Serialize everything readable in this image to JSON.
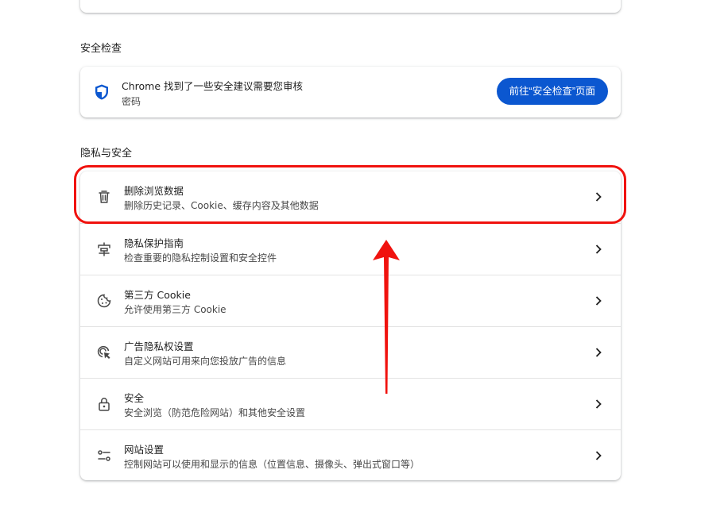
{
  "safety_check": {
    "section_title": "安全检查",
    "title": "Chrome 找到了一些安全建议需要您审核",
    "subtitle": "密码",
    "button_label": "前往“安全检查”页面"
  },
  "privacy": {
    "section_title": "隐私与安全",
    "items": [
      {
        "title": "删除浏览数据",
        "subtitle": "删除历史记录、Cookie、缓存内容及其他数据",
        "icon": "trash-icon"
      },
      {
        "title": "隐私保护指南",
        "subtitle": "检查重要的隐私控制设置和安全控件",
        "icon": "privacy-guide-icon"
      },
      {
        "title": "第三方 Cookie",
        "subtitle": "允许使用第三方 Cookie",
        "icon": "cookie-icon"
      },
      {
        "title": "广告隐私权设置",
        "subtitle": "自定义网站可用来向您投放广告的信息",
        "icon": "ad-privacy-icon"
      },
      {
        "title": "安全",
        "subtitle": "安全浏览（防范危险网站）和其他安全设置",
        "icon": "lock-icon"
      },
      {
        "title": "网站设置",
        "subtitle": "控制网站可以使用和显示的信息（位置信息、摄像头、弹出式窗口等）",
        "icon": "sliders-icon"
      }
    ]
  },
  "colors": {
    "accent": "#0b57d0",
    "highlight": "#f0120e"
  }
}
